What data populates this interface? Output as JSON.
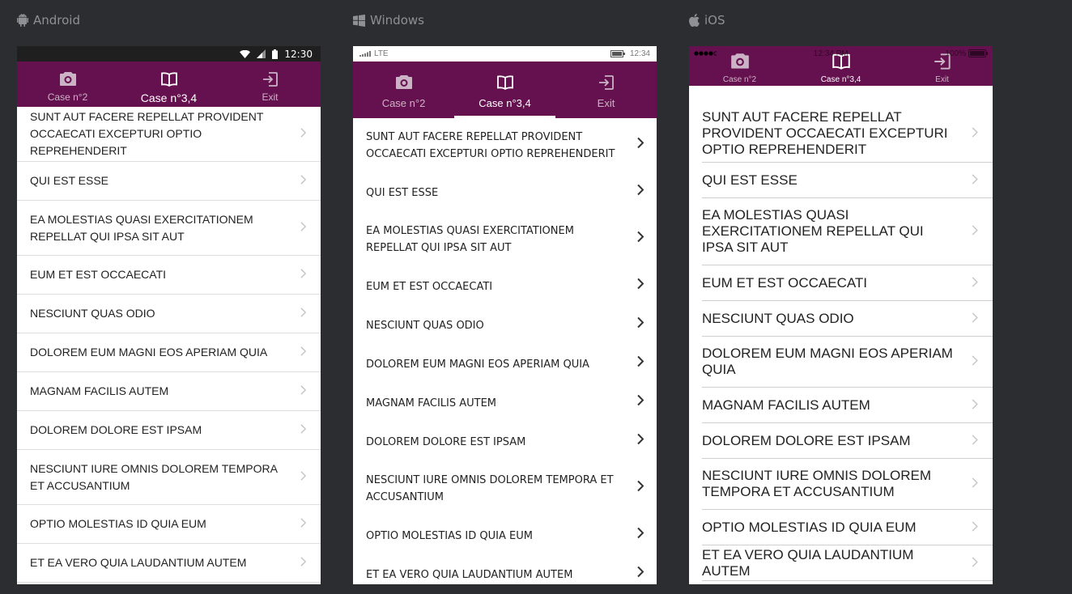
{
  "platforms": {
    "android": {
      "label": "Android",
      "status_time": "12:30",
      "tabs": [
        "Case n°2",
        "Case n°3,4",
        "Exit"
      ],
      "active_tab": 1
    },
    "windows": {
      "label": "Windows",
      "status_network": "LTE",
      "status_time": "12:34",
      "tabs": [
        "Case n°2",
        "Case n°3,4",
        "Exit"
      ],
      "active_tab": 1
    },
    "ios": {
      "label": "iOS",
      "status_time": "12:34 PM",
      "status_battery": "100%",
      "tabs": [
        "Case n°2",
        "Case n°3,4",
        "Exit"
      ],
      "active_tab": 1
    }
  },
  "tab_icons": [
    "camera-icon",
    "book-icon",
    "exit-icon"
  ],
  "items": [
    "SUNT AUT FACERE REPELLAT PROVIDENT OCCAECATI EXCEPTURI OPTIO REPREHENDERIT",
    "QUI EST ESSE",
    "EA MOLESTIAS QUASI EXERCITATIONEM REPELLAT QUI IPSA SIT AUT",
    "EUM ET EST OCCAECATI",
    "NESCIUNT QUAS ODIO",
    "DOLOREM EUM MAGNI EOS APERIAM QUIA",
    "MAGNAM FACILIS AUTEM",
    "DOLOREM DOLORE EST IPSAM",
    "NESCIUNT IURE OMNIS DOLOREM TEMPORA ET ACCUSANTIUM",
    "OPTIO MOLESTIAS ID QUIA EUM",
    "ET EA VERO QUIA LAUDANTIUM AUTEM"
  ],
  "colors": {
    "background": "#2b2d31",
    "tabbar": "#66114f",
    "tab_inactive": "#cbb3c5",
    "tab_active": "#ffffff",
    "platform_label": "#8e9096"
  }
}
